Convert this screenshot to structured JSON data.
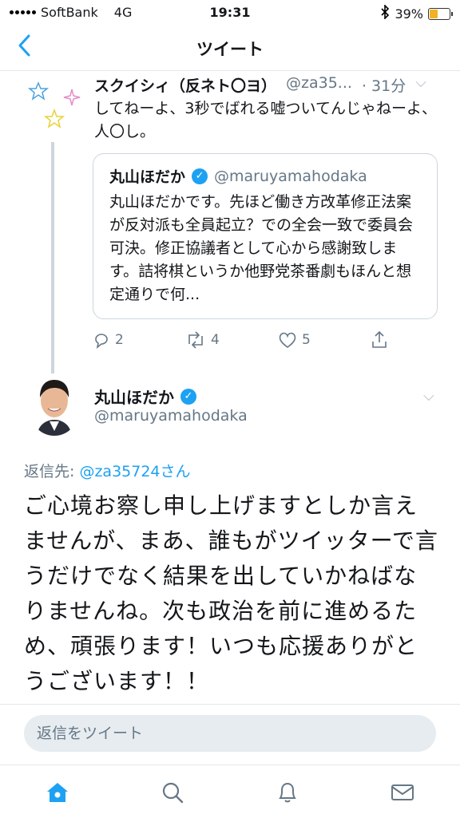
{
  "status_bar": {
    "carrier": "SoftBank",
    "network": "4G",
    "time": "19:31",
    "battery": "39%",
    "battery_level": 0.39
  },
  "nav": {
    "title": "ツイート"
  },
  "tweet1": {
    "name": "スクイシィ（反ネト〇ヨ）",
    "handle": "@za35...",
    "time": "· 31分",
    "text": "してねーよ、3秒でばれる嘘ついてんじゃねーよ、人〇し。",
    "quote": {
      "name": "丸山ほだか",
      "handle": "@maruyamahodaka",
      "text": "丸山ほだかです。先ほど働き方改革修正法案が反対派も全員起立？での全会一致で委員会可決。修正協議者として心から感謝致します。詰将棋というか他野党茶番劇もほんと想定通りで何..."
    },
    "replies": "2",
    "retweets": "4",
    "likes": "5"
  },
  "tweet2": {
    "name": "丸山ほだか",
    "handle": "@maruyamahodaka",
    "reply_prefix": "返信先: ",
    "reply_mention": "@za35724さん",
    "text": "ご心境お察し申し上げますとしか言えませんが、まあ、誰もがツイッターで言うだけでなく結果を出していかねばなりませんね。次も政治を前に進めるため、頑張ります！いつも応援ありがとうございます！！"
  },
  "reply_box": {
    "placeholder": "返信をツイート"
  },
  "colors": {
    "accent": "#1da1f2",
    "muted": "#657786",
    "border": "#e1e8ed"
  }
}
